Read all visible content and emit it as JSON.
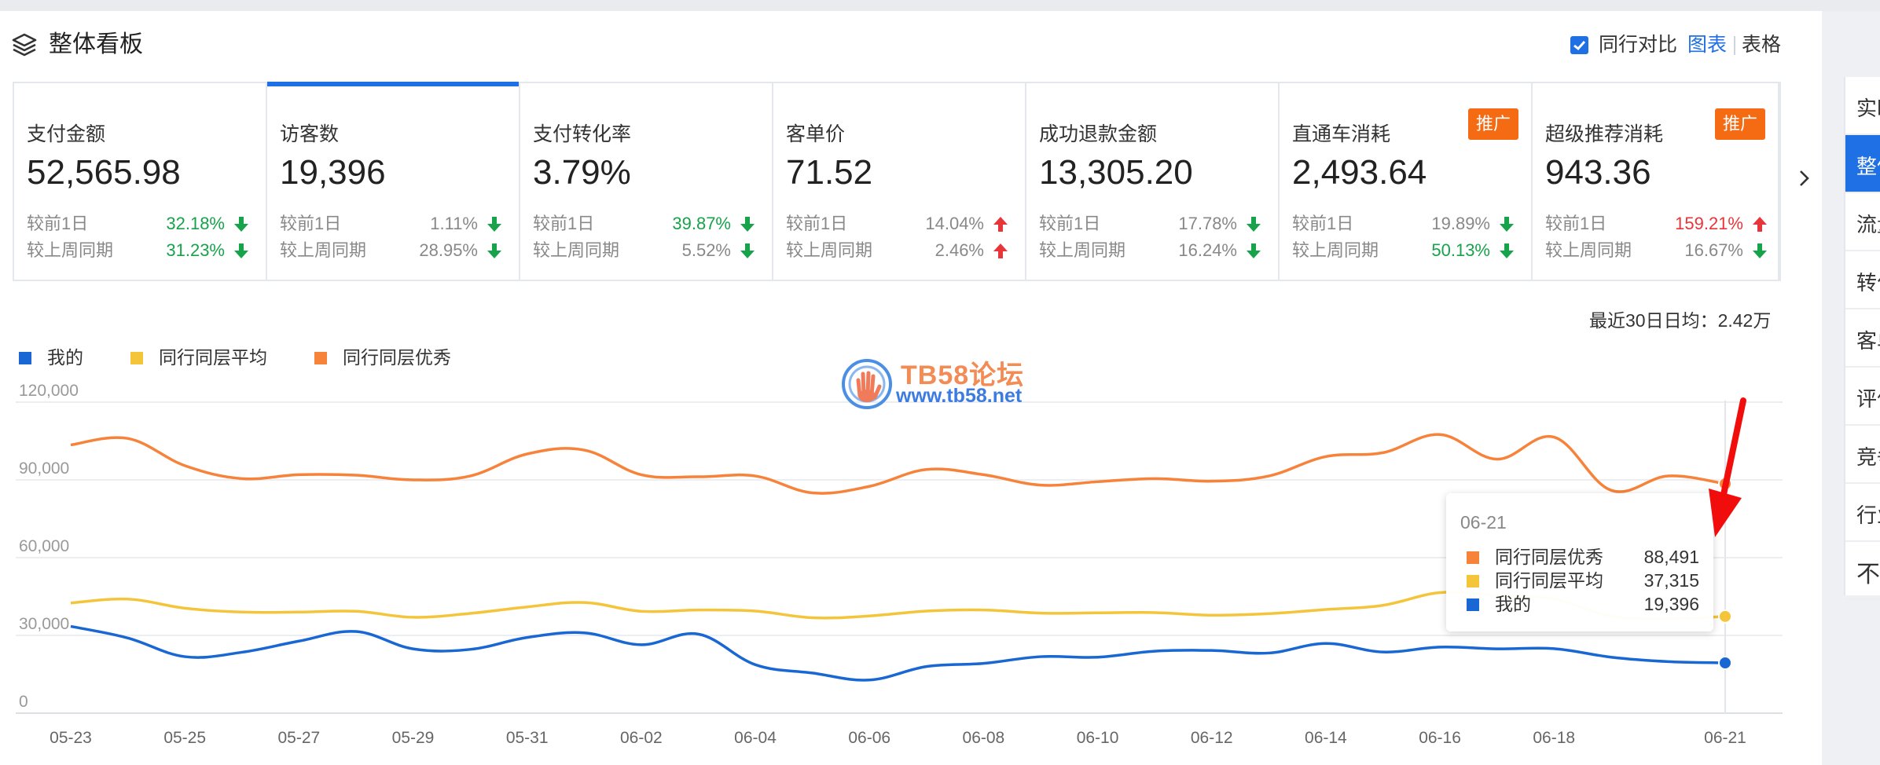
{
  "header": {
    "title": "整体看板",
    "compare_checked": true,
    "compare_label": "同行对比",
    "view_chart": "图表",
    "view_table": "表格"
  },
  "metrics": [
    {
      "title": "支付金额",
      "value": "52,565.98",
      "badge": "",
      "d1": {
        "label": "较前1日",
        "value": "32.18%",
        "color": "green",
        "dir": "down"
      },
      "w1": {
        "label": "较上周同期",
        "value": "31.23%",
        "color": "green",
        "dir": "down"
      }
    },
    {
      "title": "访客数",
      "value": "19,396",
      "badge": "",
      "active": true,
      "d1": {
        "label": "较前1日",
        "value": "1.11%",
        "color": "gray",
        "dir": "down"
      },
      "w1": {
        "label": "较上周同期",
        "value": "28.95%",
        "color": "gray",
        "dir": "down"
      }
    },
    {
      "title": "支付转化率",
      "value": "3.79%",
      "badge": "",
      "d1": {
        "label": "较前1日",
        "value": "39.87%",
        "color": "green",
        "dir": "down"
      },
      "w1": {
        "label": "较上周同期",
        "value": "5.52%",
        "color": "gray",
        "dir": "down"
      }
    },
    {
      "title": "客单价",
      "value": "71.52",
      "badge": "",
      "d1": {
        "label": "较前1日",
        "value": "14.04%",
        "color": "gray",
        "dir": "up"
      },
      "w1": {
        "label": "较上周同期",
        "value": "2.46%",
        "color": "gray",
        "dir": "up"
      }
    },
    {
      "title": "成功退款金额",
      "value": "13,305.20",
      "badge": "",
      "d1": {
        "label": "较前1日",
        "value": "17.78%",
        "color": "gray",
        "dir": "down"
      },
      "w1": {
        "label": "较上周同期",
        "value": "16.24%",
        "color": "gray",
        "dir": "down"
      }
    },
    {
      "title": "直通车消耗",
      "value": "2,493.64",
      "badge": "推广",
      "d1": {
        "label": "较前1日",
        "value": "19.89%",
        "color": "gray",
        "dir": "down"
      },
      "w1": {
        "label": "较上周同期",
        "value": "50.13%",
        "color": "green",
        "dir": "down"
      }
    },
    {
      "title": "超级推荐消耗",
      "value": "943.36",
      "badge": "推广",
      "d1": {
        "label": "较前1日",
        "value": "159.21%",
        "color": "red",
        "dir": "up"
      },
      "w1": {
        "label": "较上周同期",
        "value": "16.67%",
        "color": "gray",
        "dir": "down"
      }
    }
  ],
  "avg_note": "最近30日日均：2.42万",
  "legend": [
    {
      "name": "我的",
      "color": "#1967d2"
    },
    {
      "name": "同行同层平均",
      "color": "#f4c53a"
    },
    {
      "name": "同行同层优秀",
      "color": "#f7823a"
    }
  ],
  "watermark": {
    "title": "TB58论坛",
    "url": "www.tb58.net"
  },
  "chart_data": {
    "type": "line",
    "ylim": [
      0,
      120000
    ],
    "yticks": [
      0,
      30000,
      60000,
      90000,
      120000
    ],
    "ytick_labels": [
      "0",
      "30,000",
      "60,000",
      "90,000",
      "120,000"
    ],
    "x": [
      "05-23",
      "05-24",
      "05-25",
      "05-26",
      "05-27",
      "05-28",
      "05-29",
      "05-30",
      "05-31",
      "06-01",
      "06-02",
      "06-03",
      "06-04",
      "06-05",
      "06-06",
      "06-07",
      "06-08",
      "06-09",
      "06-10",
      "06-11",
      "06-12",
      "06-13",
      "06-14",
      "06-15",
      "06-16",
      "06-17",
      "06-18",
      "06-19",
      "06-20",
      "06-21"
    ],
    "xtick_labels": [
      "05-23",
      "05-25",
      "05-27",
      "05-29",
      "05-31",
      "06-02",
      "06-04",
      "06-06",
      "06-08",
      "06-10",
      "06-12",
      "06-14",
      "06-16",
      "06-18",
      "06-21"
    ],
    "series": [
      {
        "name": "同行同层优秀",
        "color": "#f7823a",
        "values": [
          103500,
          106000,
          95500,
          90500,
          92000,
          91800,
          90000,
          91500,
          100000,
          101500,
          92000,
          91200,
          91500,
          85000,
          87500,
          94000,
          92000,
          88000,
          89300,
          90500,
          89500,
          91500,
          99000,
          100500,
          107500,
          98000,
          106500,
          86000,
          91500,
          88491
        ]
      },
      {
        "name": "同行同层平均",
        "color": "#f4c53a",
        "values": [
          42500,
          44000,
          40500,
          39000,
          39000,
          39300,
          37000,
          38500,
          41000,
          42700,
          39300,
          39800,
          39400,
          36800,
          37500,
          39400,
          39800,
          38600,
          38700,
          38800,
          37800,
          38400,
          40000,
          41600,
          46500,
          45500,
          44000,
          37500,
          36500,
          37315
        ]
      },
      {
        "name": "我的",
        "color": "#1967d2",
        "values": [
          33500,
          29000,
          21800,
          23500,
          27800,
          31500,
          24800,
          24600,
          29200,
          31000,
          26400,
          30500,
          18700,
          15500,
          12800,
          18000,
          19200,
          21800,
          21600,
          23900,
          24200,
          23200,
          26900,
          23600,
          25500,
          24800,
          24900,
          21600,
          19900,
          19396
        ]
      }
    ]
  },
  "tooltip": {
    "date": "06-21",
    "rows": [
      {
        "name": "同行同层优秀",
        "value": "88,491",
        "color": "#f7823a"
      },
      {
        "name": "同行同层平均",
        "value": "37,315",
        "color": "#f4c53a"
      },
      {
        "name": "我的",
        "value": "19,396",
        "color": "#1967d2"
      }
    ]
  },
  "right_nav": [
    {
      "label": "实时"
    },
    {
      "label": "整体",
      "active": true
    },
    {
      "label": "流量"
    },
    {
      "label": "转化"
    },
    {
      "label": "客单"
    },
    {
      "label": "评价"
    },
    {
      "label": "竞争"
    },
    {
      "label": "行业"
    },
    {
      "label": "不"
    }
  ]
}
